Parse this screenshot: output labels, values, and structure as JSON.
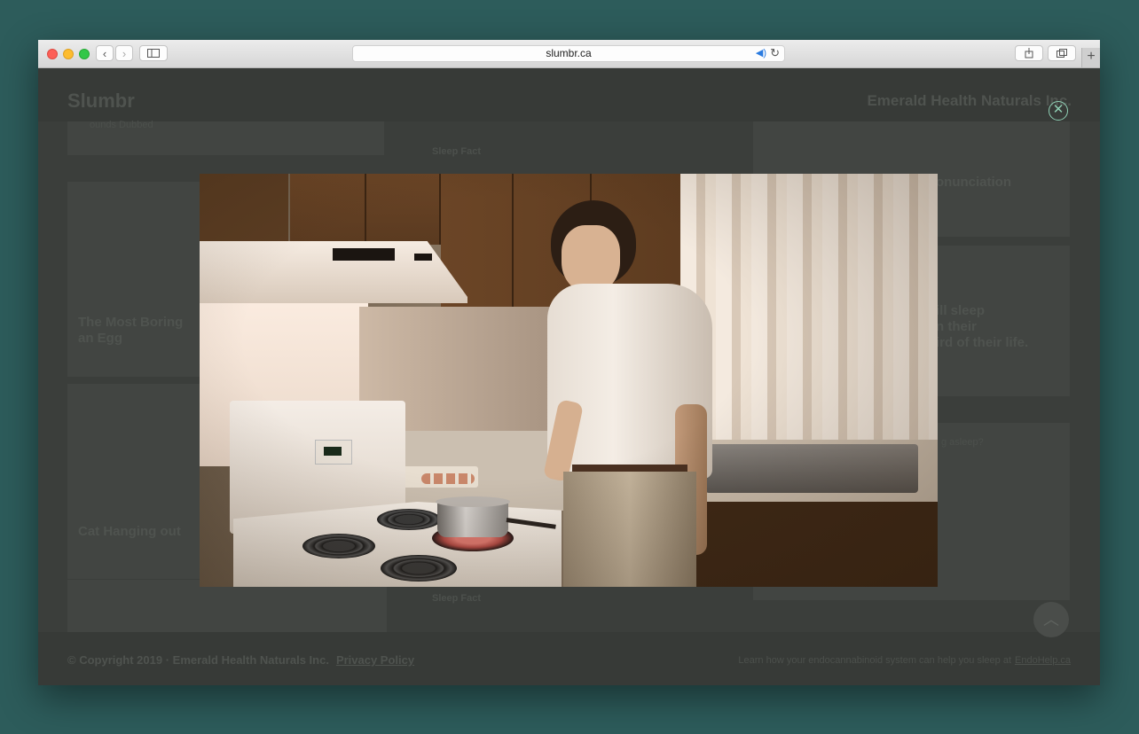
{
  "browser": {
    "url": "slumbr.ca",
    "back_icon": "chevron-left-icon",
    "forward_icon": "chevron-right-icon"
  },
  "site": {
    "brand": "Slumbr",
    "company": "Emerald Health Naturals Inc."
  },
  "background_cards": {
    "card1_title": "The Most Boring",
    "card1_title_2": "an Egg",
    "card2_title": "Cat Hanging out",
    "sleep_fact_1": "Sleep Fact",
    "sleep_fact_2": "Sleep Fact",
    "pronunciation": "onunciation",
    "fact_line1": "ill sleep",
    "fact_line2": "n their",
    "fact_line3": "ird of their life.",
    "small_label": "ounds Dubbed",
    "question": "g asleep?"
  },
  "footer": {
    "copyright": "© Copyright 2019 · Emerald Health Naturals Inc.",
    "privacy": "Privacy Policy",
    "learn": "Learn how your endocannabinoid system can help you sleep at",
    "link": "EndoHelp.ca"
  },
  "modal": {
    "close_icon": "close-icon"
  },
  "colors": {
    "accent": "#8fcfb4",
    "desktop": "#2d5c5b"
  }
}
